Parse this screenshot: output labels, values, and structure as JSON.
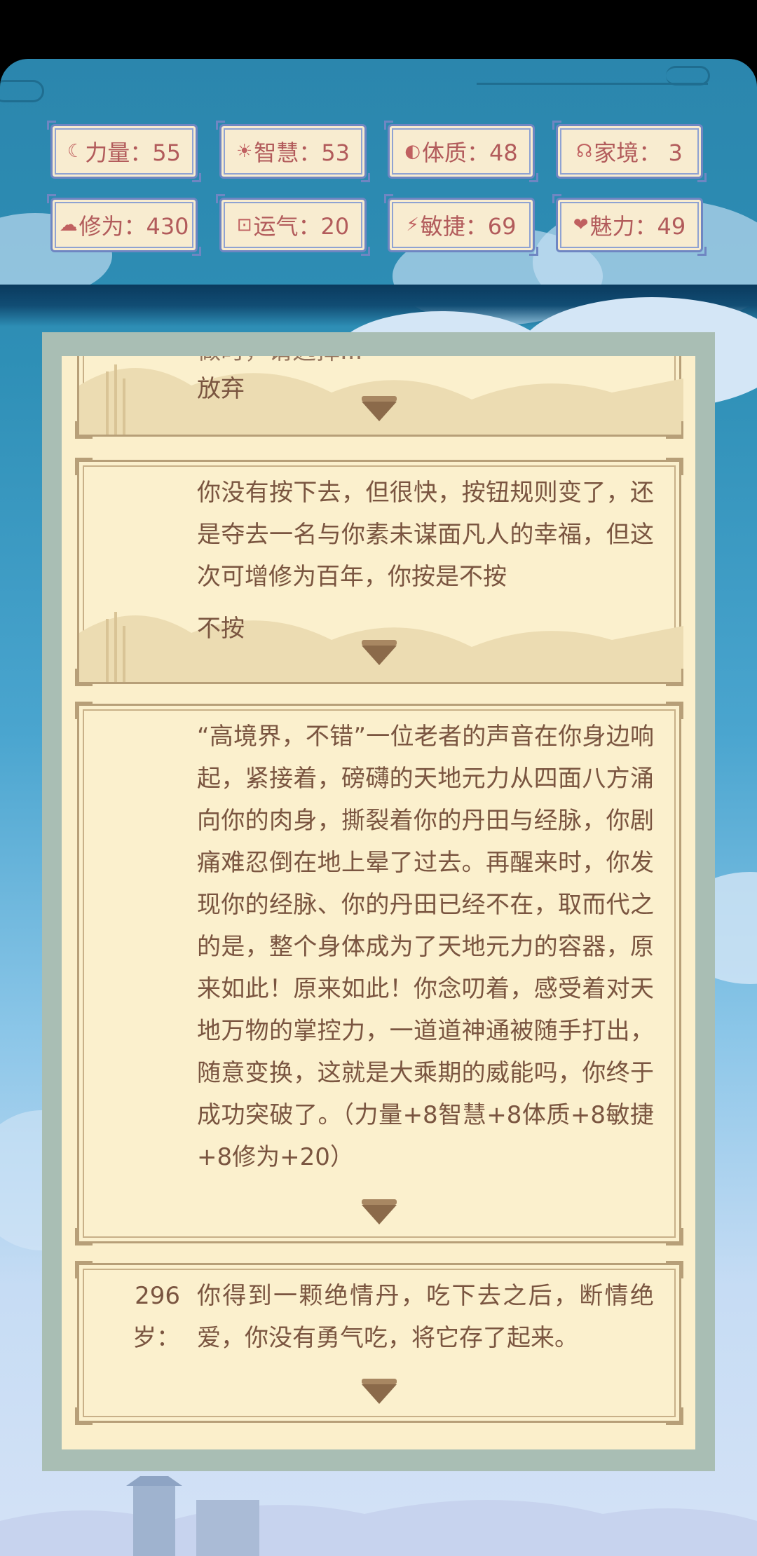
{
  "stats": [
    {
      "icon": "☾",
      "label": "力量：55"
    },
    {
      "icon": "☀",
      "label": "智慧：53"
    },
    {
      "icon": "◐",
      "label": "体质：48"
    },
    {
      "icon": "☊",
      "label": "家境： 3"
    },
    {
      "icon": "☁",
      "label": "修为：430"
    },
    {
      "icon": "⊡",
      "label": "运气：20"
    },
    {
      "icon": "⚡",
      "label": "敏捷：69"
    },
    {
      "icon": "❤",
      "label": "魅力：49"
    }
  ],
  "events": [
    {
      "age": "",
      "lines": [
        "做时，请选择..."
      ],
      "choice": "放弃"
    },
    {
      "age": "",
      "text": "你没有按下去，但很快，按钮规则变了，还是夺去一名与你素未谋面凡人的幸福，但这次可增修为百年，你按是不按",
      "choice": "不按"
    },
    {
      "age": "",
      "text": "“高境界，不错”一位老者的声音在你身边响起，紧接着，磅礴的天地元力从四面八方涌向你的肉身，撕裂着你的丹田与经脉，你剧痛难忍倒在地上晕了过去。再醒来时，你发现你的经脉、你的丹田已经不在，取而代之的是，整个身体成为了天地元力的容器，原来如此！原来如此！你念叨着，感受着对天地万物的掌控力，一道道神通被随手打出，随意变换，这就是大乘期的威能吗，你终于成功突破了。（力量+8智慧+8体质+8敏捷+8修为+20）"
    },
    {
      "age": "296岁：",
      "text": "你得到一颗绝情丹，吃下去之后，断情绝爱，你没有勇气吃，将它存了起来。"
    }
  ]
}
